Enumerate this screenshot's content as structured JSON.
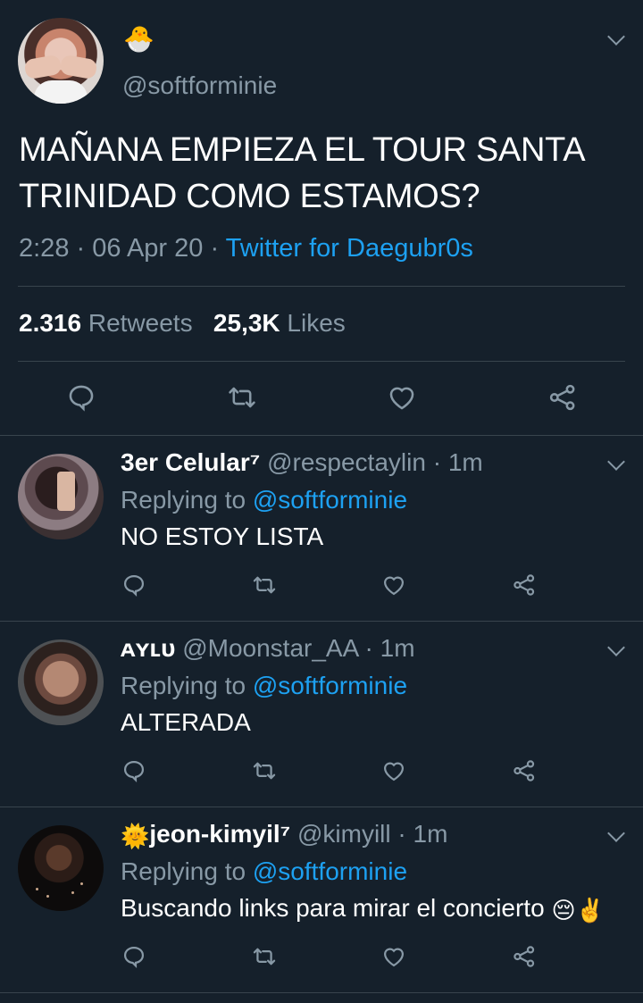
{
  "main": {
    "name_emoji": "🐣",
    "handle": "@softforminie",
    "text": "MAÑANA EMPIEZA EL TOUR SANTA TRINIDAD COMO ESTAMOS?",
    "time": "2:28",
    "date": "06 Apr 20",
    "source": "Twitter for Daegubr0s",
    "retweets_count": "2.316",
    "retweets_label": "Retweets",
    "likes_count": "25,3K",
    "likes_label": "Likes"
  },
  "replies": [
    {
      "name": "3er Celular⁷",
      "handle": "@respectaylin",
      "time": "1m",
      "replying_prefix": "Replying to",
      "replying_to": "@softforminie",
      "text": "NO ESTOY LISTA"
    },
    {
      "name": "ᴀʏʟᴜ",
      "handle": "@Moonstar_AA",
      "time": "1m",
      "replying_prefix": "Replying to",
      "replying_to": "@softforminie",
      "text": "ALTERADA"
    },
    {
      "name_prefix_emoji": "🌞",
      "name": "jeon-kimyil⁷",
      "handle": "@kimyill",
      "time": "1m",
      "replying_prefix": "Replying to",
      "replying_to": "@softforminie",
      "text": "Buscando links para mirar el concierto",
      "text_emojis": "😔✌️"
    }
  ],
  "colors": {
    "background": "#15202b",
    "text": "#ffffff",
    "secondary": "#8899a6",
    "link": "#1da1f2",
    "divider": "#38444d"
  },
  "icons": [
    "reply-icon",
    "retweet-icon",
    "like-icon",
    "share-icon",
    "chevron-down-icon"
  ]
}
